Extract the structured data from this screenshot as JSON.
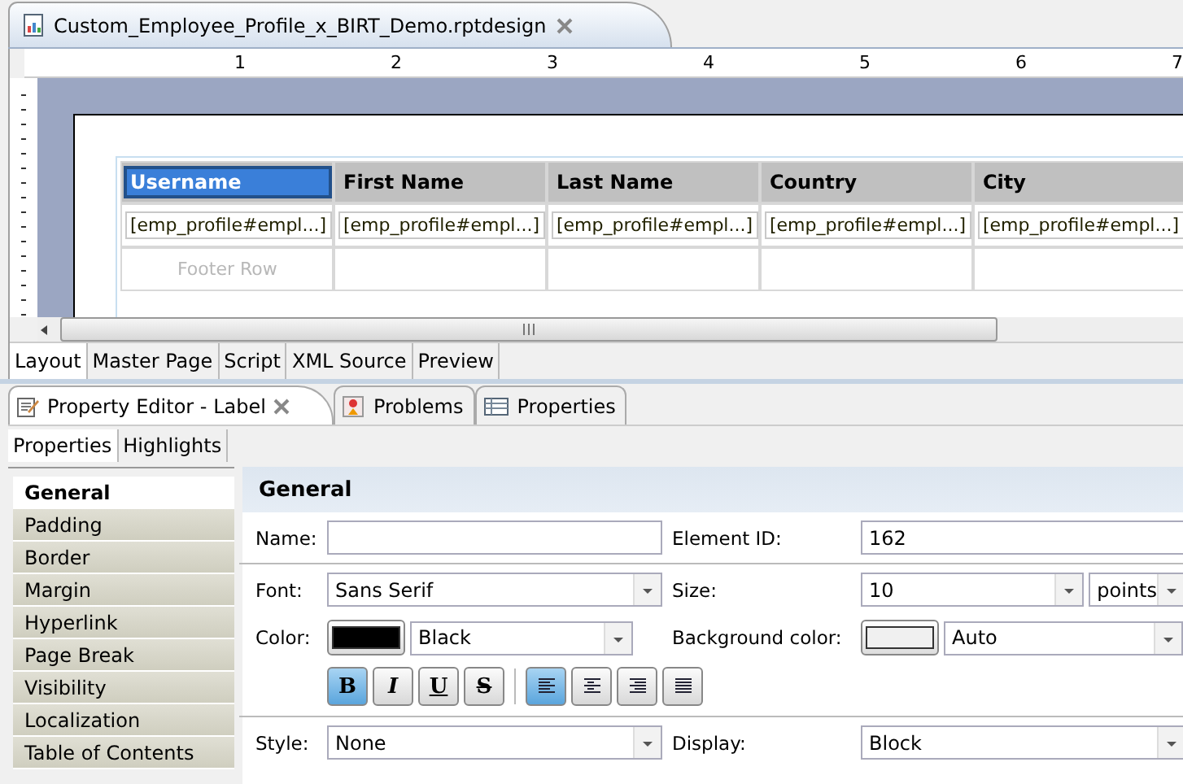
{
  "editor": {
    "file_tab": {
      "title": "Custom_Employee_Profile_x_BIRT_Demo.rptdesign",
      "closable": true
    },
    "ruler_labels": [
      "1",
      "2",
      "3",
      "4",
      "5",
      "6",
      "7"
    ],
    "table": {
      "columns": [
        {
          "header": "Username",
          "selected": true,
          "cell": "[emp_profile#empl...]"
        },
        {
          "header": "First Name",
          "selected": false,
          "cell": "[emp_profile#empl...]"
        },
        {
          "header": "Last Name",
          "selected": false,
          "cell": "[emp_profile#empl...]"
        },
        {
          "header": "Country",
          "selected": false,
          "cell": "[emp_profile#empl...]"
        },
        {
          "header": "City",
          "selected": false,
          "cell": "[emp_profile#empl...]"
        }
      ],
      "footer_label": "Footer Row"
    },
    "view_tabs": [
      {
        "label": "Layout",
        "selected": true
      },
      {
        "label": "Master Page",
        "selected": false
      },
      {
        "label": "Script",
        "selected": false
      },
      {
        "label": "XML Source",
        "selected": false
      },
      {
        "label": "Preview",
        "selected": false
      }
    ]
  },
  "panel": {
    "tabs": [
      {
        "label": "Property Editor - Label",
        "kind": "editor",
        "selected": true,
        "closable": true
      },
      {
        "label": "Problems",
        "kind": "problems",
        "selected": false,
        "closable": false
      },
      {
        "label": "Properties",
        "kind": "properties",
        "selected": false,
        "closable": false
      }
    ],
    "subtabs": [
      {
        "label": "Properties",
        "selected": true
      },
      {
        "label": "Highlights",
        "selected": false
      }
    ],
    "categories": [
      {
        "label": "General",
        "selected": true
      },
      {
        "label": "Padding",
        "selected": false
      },
      {
        "label": "Border",
        "selected": false
      },
      {
        "label": "Margin",
        "selected": false
      },
      {
        "label": "Hyperlink",
        "selected": false
      },
      {
        "label": "Page Break",
        "selected": false
      },
      {
        "label": "Visibility",
        "selected": false
      },
      {
        "label": "Localization",
        "selected": false
      },
      {
        "label": "Table of Contents",
        "selected": false
      }
    ],
    "section_title": "General",
    "name": {
      "label": "Name:"
    },
    "element_id": {
      "label": "Element ID:",
      "value": "162"
    },
    "font": {
      "label": "Font:",
      "value": "Sans Serif"
    },
    "size": {
      "label": "Size:",
      "value": "10",
      "unit": "points"
    },
    "color": {
      "label": "Color:",
      "value": "Black"
    },
    "background_color": {
      "label": "Background color:",
      "value": "Auto"
    },
    "format_buttons": [
      {
        "kind": "bold",
        "text": "B",
        "selected": true
      },
      {
        "kind": "italic",
        "text": "I",
        "selected": false
      },
      {
        "kind": "underline",
        "text": "U",
        "selected": false
      },
      {
        "kind": "strike",
        "text": "S",
        "selected": false
      }
    ],
    "align_buttons": [
      {
        "kind": "left",
        "selected": true
      },
      {
        "kind": "center",
        "selected": false
      },
      {
        "kind": "right",
        "selected": false
      },
      {
        "kind": "justify",
        "selected": false
      }
    ],
    "style": {
      "label": "Style:",
      "value": "None"
    },
    "display": {
      "label": "Display:",
      "value": "Block"
    }
  }
}
